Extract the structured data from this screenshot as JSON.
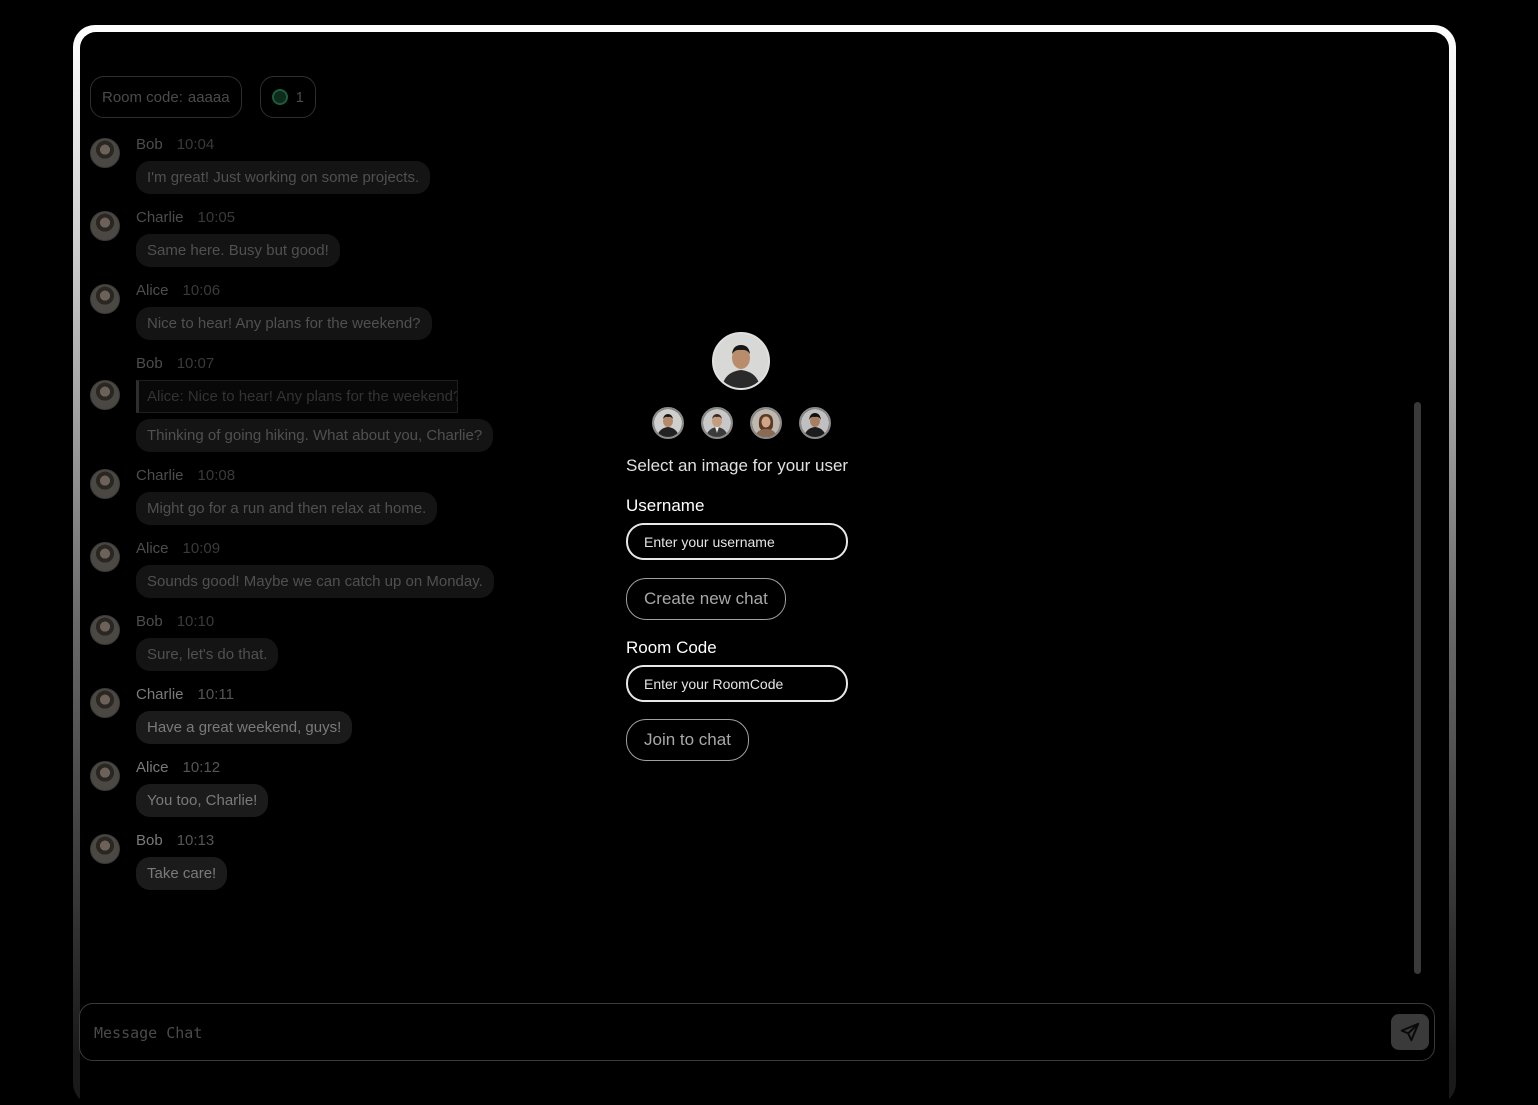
{
  "room": {
    "code_label": "Room code:",
    "code_value": "aaaaa",
    "online_count": "1"
  },
  "messages": [
    {
      "user": "Bob",
      "time": "10:04",
      "text": "I'm great! Just working on some projects."
    },
    {
      "user": "Charlie",
      "time": "10:05",
      "text": "Same here. Busy but good!"
    },
    {
      "user": "Alice",
      "time": "10:06",
      "text": "Nice to hear! Any plans for the weekend?"
    },
    {
      "user": "Bob",
      "time": "10:07",
      "quote": "Alice: Nice to hear! Any plans for the weekend?",
      "text": "Thinking of going hiking. What about you, Charlie?"
    },
    {
      "user": "Charlie",
      "time": "10:08",
      "text": "Might go for a run and then relax at home."
    },
    {
      "user": "Alice",
      "time": "10:09",
      "text": "Sounds good! Maybe we can catch up on Monday."
    },
    {
      "user": "Bob",
      "time": "10:10",
      "text": "Sure, let's do that."
    },
    {
      "user": "Charlie",
      "time": "10:11",
      "text": "Have a great weekend, guys!"
    },
    {
      "user": "Alice",
      "time": "10:12",
      "text": "You too, Charlie!"
    },
    {
      "user": "Bob",
      "time": "10:13",
      "text": "Take care!"
    }
  ],
  "composer": {
    "placeholder": "Message Chat",
    "send_icon": "send-icon"
  },
  "modal": {
    "select_text": "Select an image for your user",
    "username_label": "Username",
    "username_placeholder": "Enter your username",
    "create_button": "Create new chat",
    "room_code_label": "Room Code",
    "room_code_placeholder": "Enter your RoomCode",
    "join_button": "Join to chat"
  },
  "colors": {
    "background": "#000000",
    "online_indicator": "#1e5b3a",
    "modal_text": "#ffffff"
  }
}
